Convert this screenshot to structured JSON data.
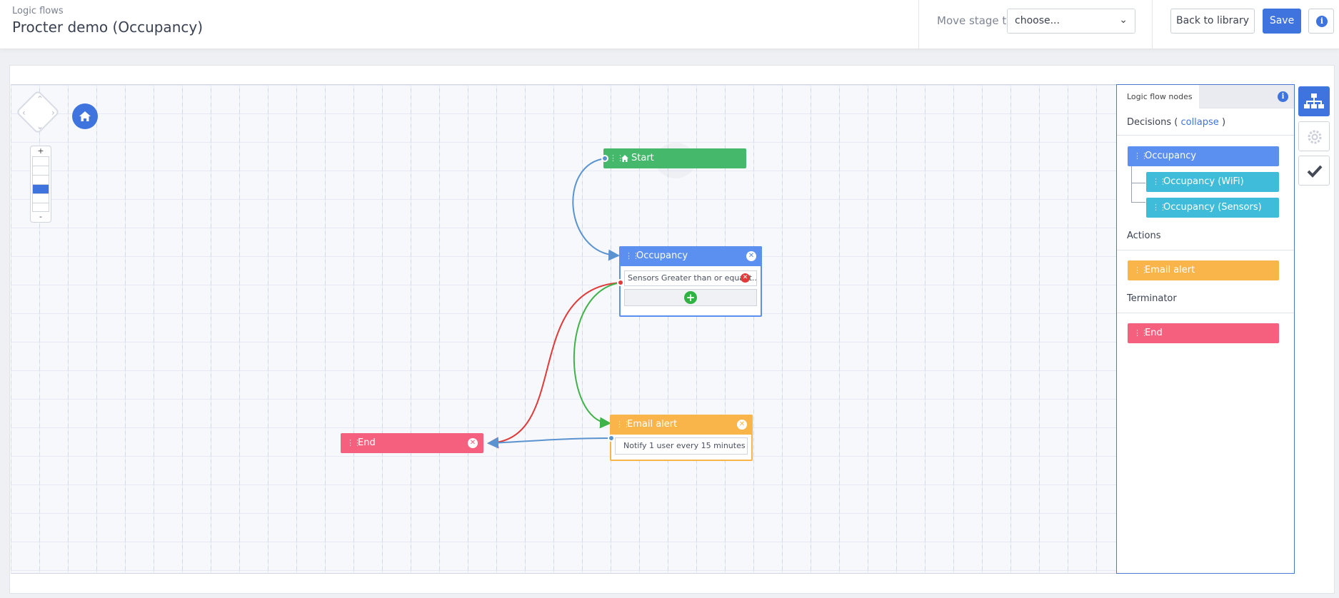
{
  "header": {
    "breadcrumb": "Logic flows",
    "title": "Procter demo (Occupancy)",
    "move_stage_label": "Move stage to",
    "stage_select_value": "choose...",
    "back_button": "Back to library",
    "save_button": "Save",
    "info_icon": "i"
  },
  "canvas": {
    "zoom_plus": "+",
    "zoom_minus": "-",
    "nodes": {
      "start": {
        "label": "Start",
        "color": "#45b86c"
      },
      "occupancy": {
        "label": "Occupancy",
        "color": "#5b8ff0",
        "condition": "Sensors Greater than or equal t..."
      },
      "email_alert": {
        "label": "Email alert",
        "color": "#f9b44a",
        "detail": "Notify 1 user every 15 minutes"
      },
      "end": {
        "label": "End",
        "color": "#f6607f"
      }
    },
    "connector_colors": {
      "default": "#5a93cf",
      "false": "#e03a3a",
      "true": "#3fb34a"
    }
  },
  "palette": {
    "tab": "Logic flow nodes",
    "info_icon": "i",
    "decisions_title": "Decisions (",
    "decisions_link": "collapse",
    "decisions_close": ")",
    "decisions": [
      "Occupancy",
      "Occupancy (WiFi)",
      "Occupancy (Sensors)"
    ],
    "actions_title": "Actions",
    "actions": [
      "Email alert"
    ],
    "terminator_title": "Terminator",
    "terminators": [
      "End"
    ]
  },
  "tools": [
    "flow-tree-icon",
    "gear-icon",
    "checkmark-icon"
  ]
}
